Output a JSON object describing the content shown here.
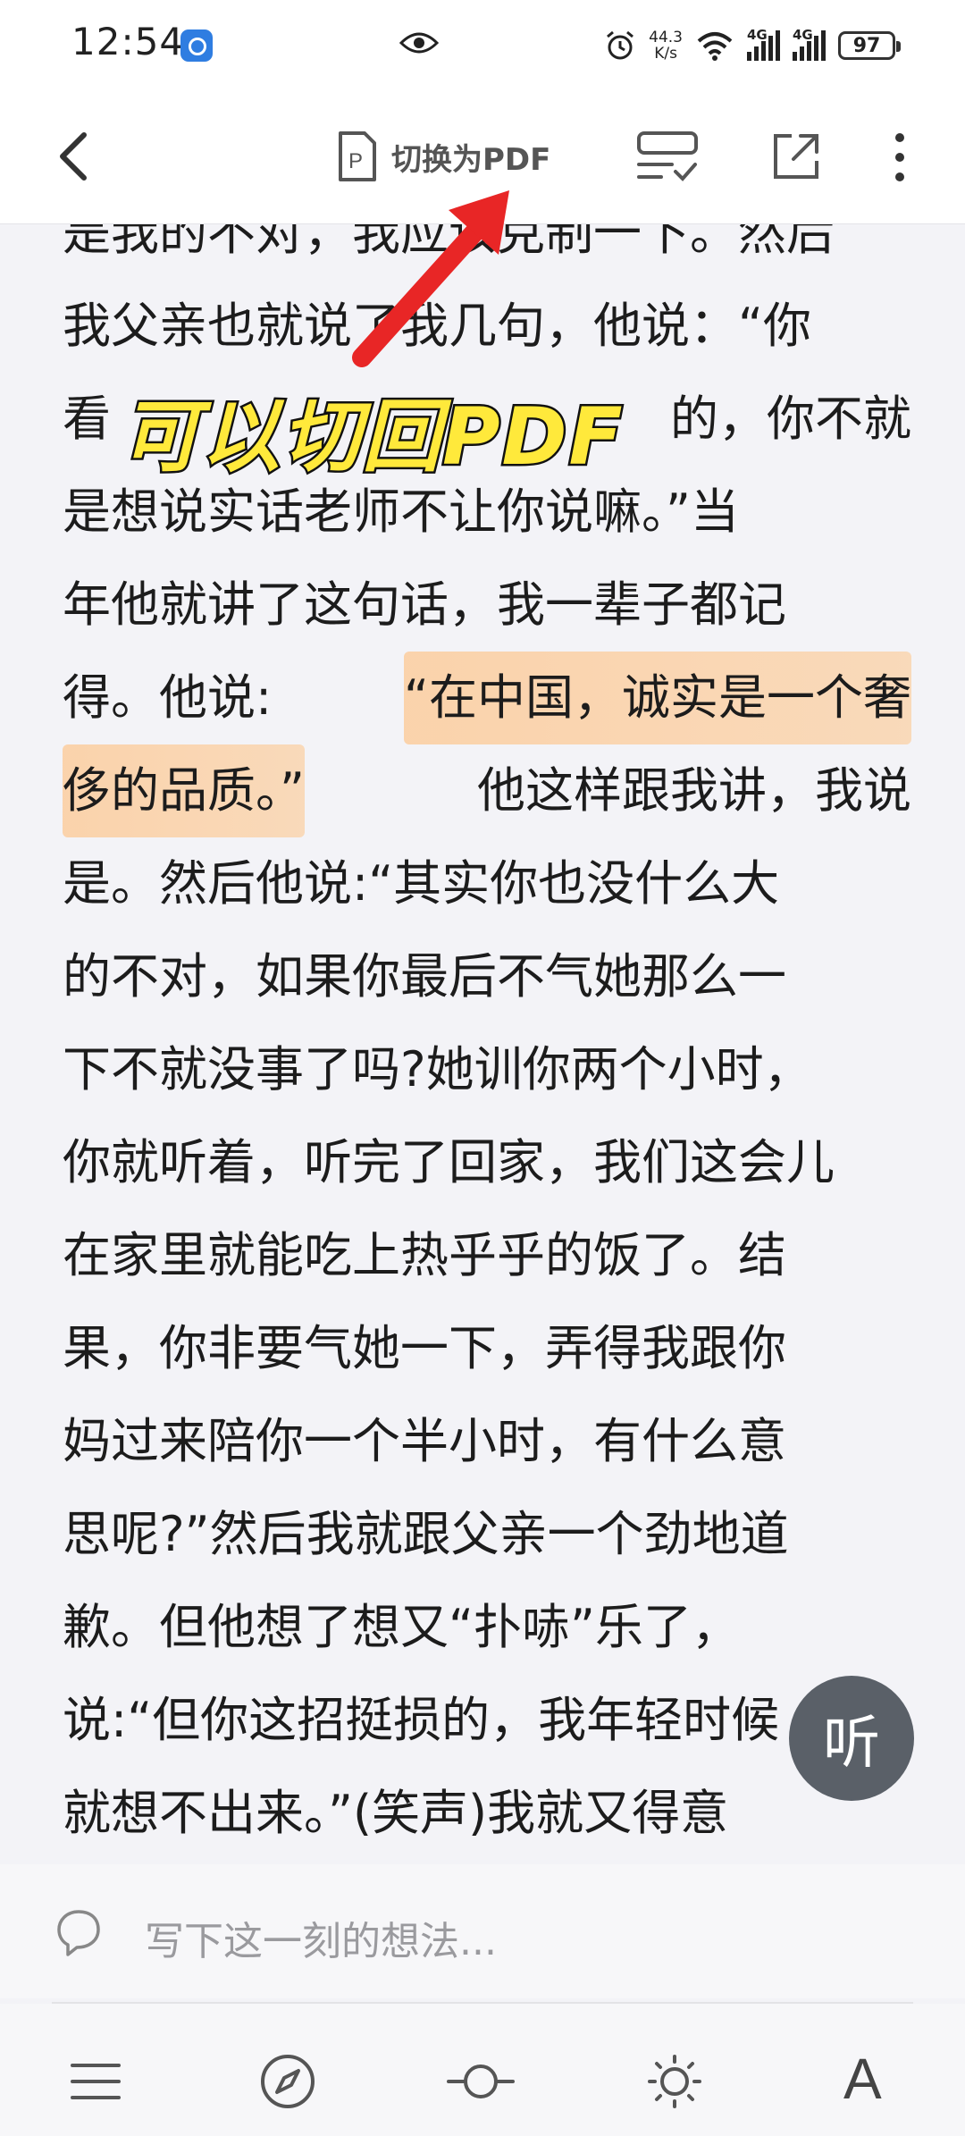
{
  "status_bar": {
    "time": "12:54",
    "net_speed_value": "44.3",
    "net_speed_unit": "K/s",
    "signal1_tag": "4G",
    "signal2_tag": "4G",
    "battery": "97"
  },
  "toolbar": {
    "switch_pdf_label": "切换为PDF"
  },
  "annotation": {
    "text": "可以切回PDF"
  },
  "reader": {
    "lines": [
      {
        "segments": [
          "是我的不对，我应该克制一下。然后"
        ]
      },
      {
        "segments": [
          "我父亲也就说了我几句，他说：“你"
        ]
      },
      {
        "segments": [
          "看",
          "的，你不就"
        ]
      },
      {
        "segments": [
          "是想说实话老师不让你说嘛。”当"
        ]
      },
      {
        "segments": [
          "年他就讲了这句话，我一辈子都记"
        ]
      },
      {
        "prefix": "得。他说:",
        "highlight": "“在中国，诚实是一个奢"
      },
      {
        "highlight": "侈的品质。”",
        "suffix": "他这样跟我讲，我说"
      },
      {
        "segments": [
          "是。然后他说:“其实你也没什么大"
        ]
      },
      {
        "segments": [
          "的不对，如果你最后不气她那么一"
        ]
      },
      {
        "segments": [
          "下不就没事了吗?她训你两个小时，"
        ]
      },
      {
        "segments": [
          "你就听着，听完了回家，我们这会儿"
        ]
      },
      {
        "segments": [
          "在家里就能吃上热乎乎的饭了。结"
        ]
      },
      {
        "segments": [
          "果，你非要气她一下，弄得我跟你"
        ]
      },
      {
        "segments": [
          "妈过来陪你一个半小时，有什么意"
        ]
      },
      {
        "segments": [
          "思呢?”然后我就跟父亲一个劲地道"
        ]
      },
      {
        "segments": [
          "歉。但他想了想又“扑哧”乐了，"
        ]
      },
      {
        "segments": [
          "说:“但你这招挺损的，我年轻时候"
        ]
      },
      {
        "segments": [
          "就想不出来。”(笑声)我就又得意"
        ]
      }
    ]
  },
  "listen_button": {
    "label": "听"
  },
  "comment_bar": {
    "placeholder": "写下这一刻的想法..."
  },
  "bottom_nav": {
    "icons": [
      "menu-icon",
      "compass-icon",
      "progress-slider-icon",
      "brightness-icon",
      "font-icon"
    ],
    "font_label": "A"
  }
}
